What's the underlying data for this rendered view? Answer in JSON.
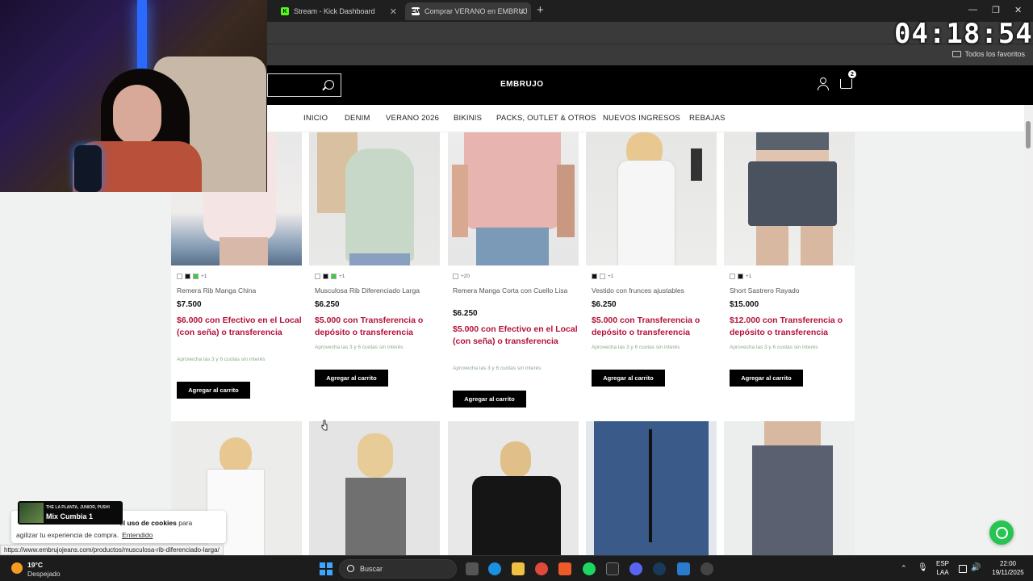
{
  "browser": {
    "tabs": [
      {
        "label": "Stream - Kick Dashboard",
        "fav": "K",
        "fav_color": "#53fc18"
      },
      {
        "label": "Comprar VERANO en EMBRUJ",
        "fav": "EM",
        "fav_color": "#ffffff"
      }
    ],
    "bookmarks_folder": "Todos los favoritos"
  },
  "overlay": {
    "clock": "04:18:54",
    "music": {
      "artist": "THE LA PLANTA, JUNIOR, PUSHI",
      "track": "Mix Cumbia 1"
    },
    "status_url": "https://www.embrujojeans.com/productos/musculosa-rib-diferenciado-larga/"
  },
  "store": {
    "logo": "EMBRUJO",
    "cart_count": "2",
    "nav": [
      "INICIO",
      "DENIM",
      "VERANO 2026",
      "BIKINIS",
      "PACKS, OUTLET & OTROS",
      "NUEVOS INGRESOS",
      "REBAJAS"
    ],
    "products": [
      {
        "name": "Remera Rib Manga China",
        "price": "$7.500",
        "promo": "$6.000 con Efectivo en el Local (con seña) o transferencia",
        "installments": "Aprovecha las 3 y 6 cuotas sin interés",
        "more_colors": "+1",
        "swatches": [
          "#ffffff",
          "#111111",
          "#3ccc3c"
        ],
        "button": "Agregar al carrito"
      },
      {
        "name": "Musculosa Rib Diferenciado Larga",
        "price": "$6.250",
        "promo": "$5.000 con Transferencia o depósito o transferencia",
        "installments": "Aprovecha las 3 y 6 cuotas sin interés",
        "more_colors": "+1",
        "swatches": [
          "#ffffff",
          "#111111",
          "#3ccc3c"
        ],
        "button": "Agregar al carrito"
      },
      {
        "name": "Remera Manga Corta con Cuello Lisa",
        "price": "$6.250",
        "promo": "$5.000 con Efectivo en el Local (con seña) o transferencia",
        "installments": "Aprovecha las 3 y 6 cuotas sin interés",
        "more_colors": "+20",
        "swatches": [
          "#ffffff"
        ],
        "button": "Agregar al carrito"
      },
      {
        "name": "Vestido con frunces ajustables",
        "price": "$6.250",
        "promo": "$5.000 con Transferencia o depósito o transferencia",
        "installments": "Aprovecha las 3 y 6 cuotas sin interés",
        "more_colors": "+1",
        "swatches": [
          "#111111",
          "#ffffff"
        ],
        "button": "Agregar al carrito"
      },
      {
        "name": "Short Sastrero Rayado",
        "price": "$15.000",
        "promo": "$12.000 con Transferencia o depósito o transferencia",
        "installments": "Aprovecha las 3 y 6 cuotas sin interés",
        "more_colors": "+1",
        "swatches": [
          "#ffffff",
          "#111111"
        ],
        "button": "Agregar al carrito"
      }
    ],
    "cookie": {
      "pre": "el uso de cookies",
      "text1": "para",
      "text2": "agilizar tu experiencia de compra.",
      "accept": "Entendido"
    }
  },
  "taskbar": {
    "temp": "19°C",
    "weather": "Despejado",
    "search": "Buscar",
    "lang1": "ESP",
    "lang2": "LAA",
    "time": "22:00",
    "date": "19/11/2025"
  }
}
